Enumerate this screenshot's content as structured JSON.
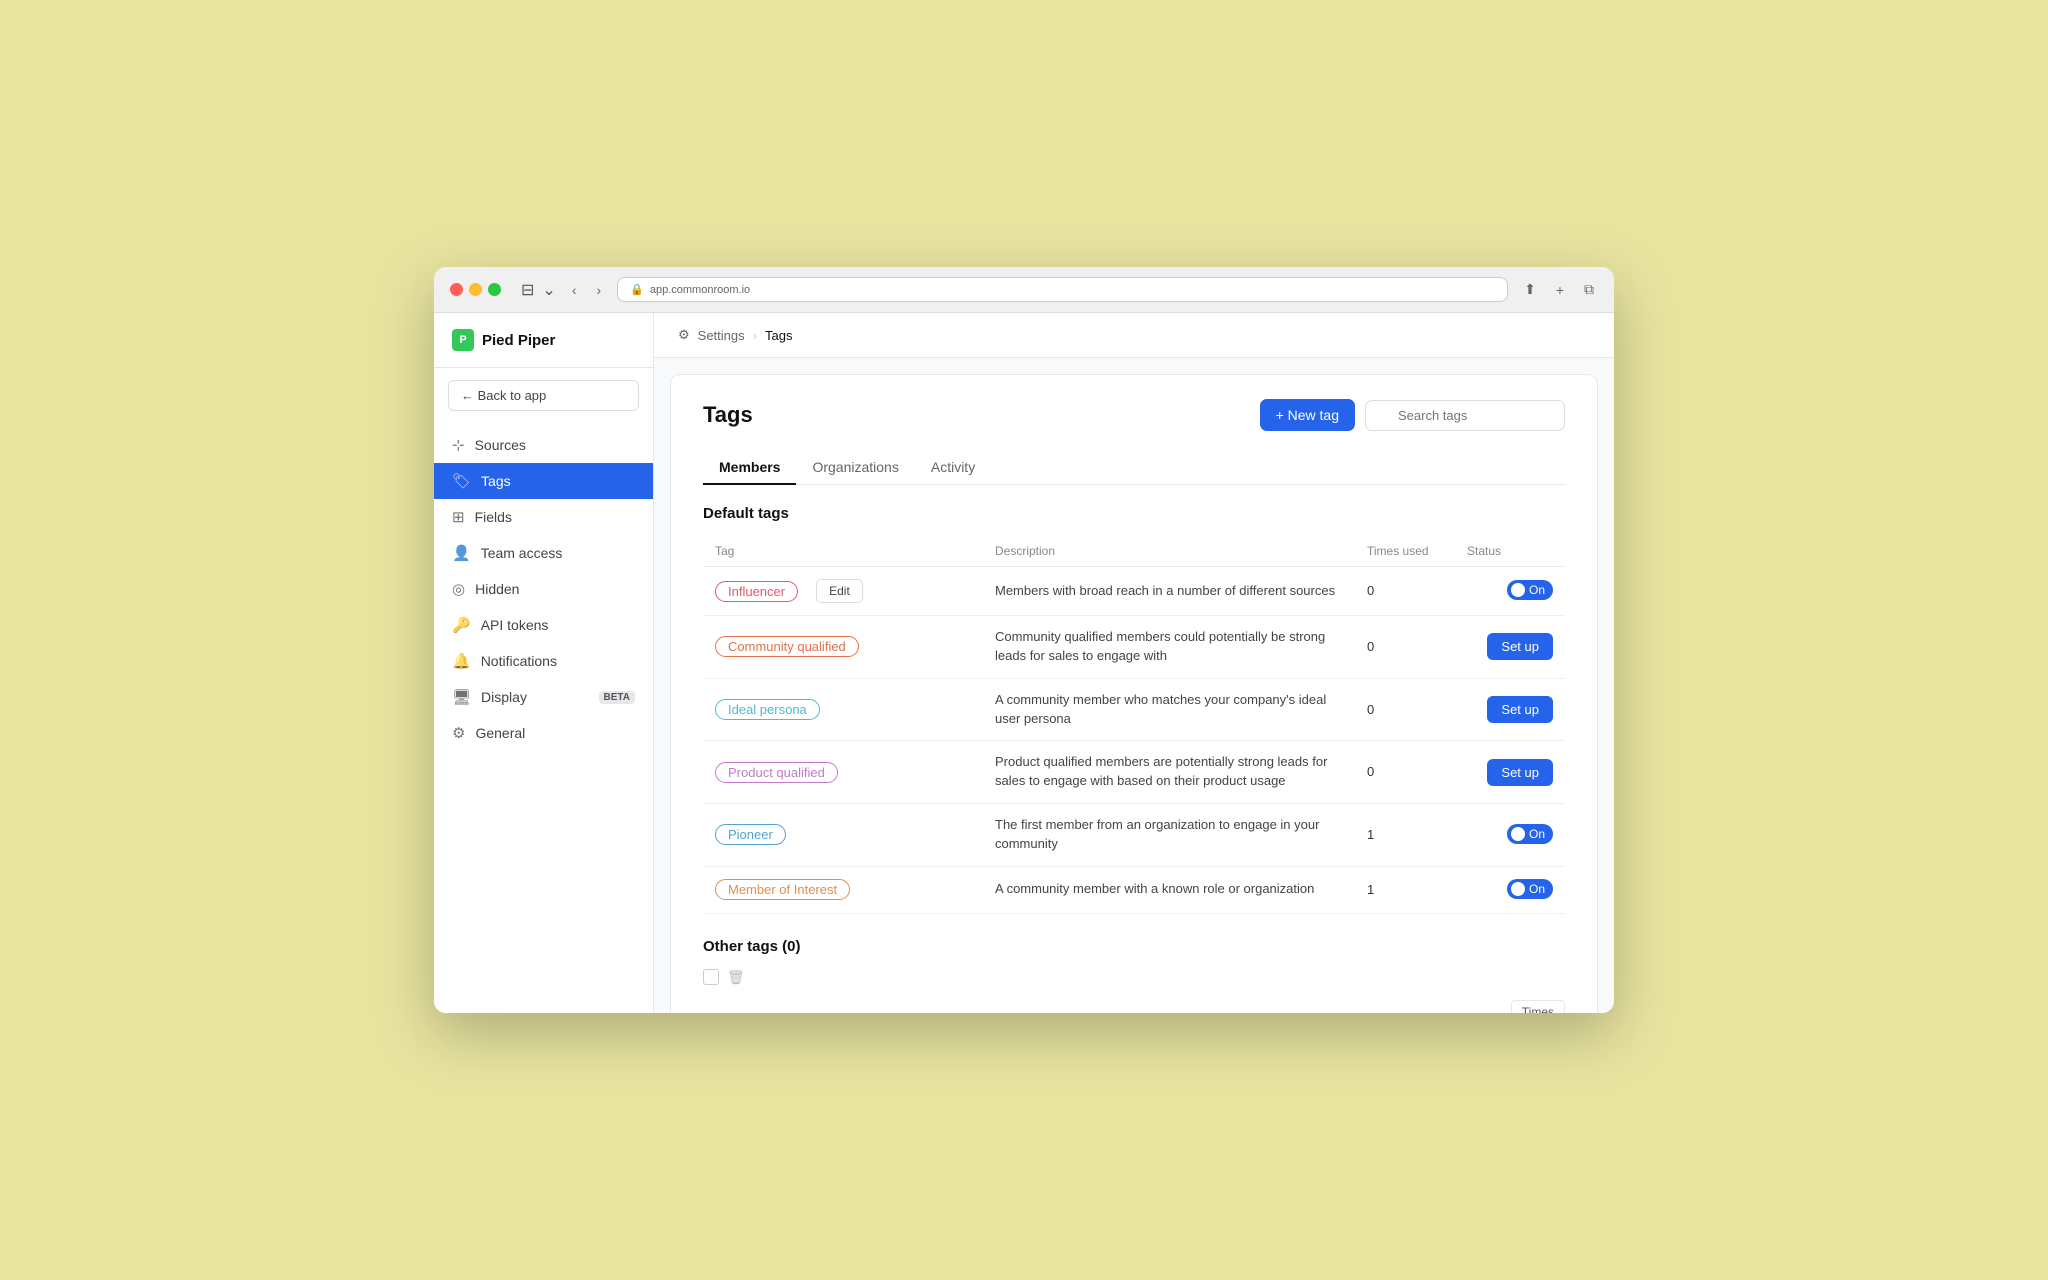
{
  "browser": {
    "url": "app.commonroom.io",
    "reload_icon": "↻"
  },
  "sidebar": {
    "brand": "Pied Piper",
    "back_label": "← Back to app",
    "nav_items": [
      {
        "id": "sources",
        "label": "Sources",
        "icon": "⊹",
        "active": false
      },
      {
        "id": "tags",
        "label": "Tags",
        "icon": "🏷",
        "active": true
      },
      {
        "id": "fields",
        "label": "Fields",
        "icon": "⊞",
        "active": false
      },
      {
        "id": "team-access",
        "label": "Team access",
        "icon": "👤",
        "active": false
      },
      {
        "id": "hidden",
        "label": "Hidden",
        "icon": "◎",
        "active": false
      },
      {
        "id": "api-tokens",
        "label": "API tokens",
        "icon": "🔑",
        "active": false
      },
      {
        "id": "notifications",
        "label": "Notifications",
        "icon": "🔔",
        "active": false
      },
      {
        "id": "display",
        "label": "Display",
        "icon": "🖥",
        "active": false,
        "badge": "BETA"
      },
      {
        "id": "general",
        "label": "General",
        "icon": "⚙",
        "active": false
      }
    ]
  },
  "breadcrumb": {
    "parent": "Settings",
    "current": "Tags"
  },
  "page": {
    "title": "Tags",
    "new_tag_label": "+ New tag",
    "search_placeholder": "Search tags"
  },
  "tabs": [
    {
      "id": "members",
      "label": "Members",
      "active": true
    },
    {
      "id": "organizations",
      "label": "Organizations",
      "active": false
    },
    {
      "id": "activity",
      "label": "Activity",
      "active": false
    }
  ],
  "default_tags_section": {
    "title": "Default tags",
    "columns": [
      "Tag",
      "Description",
      "Times used",
      "Status"
    ],
    "rows": [
      {
        "tag_label": "Influencer",
        "tag_class": "tag-influencer",
        "show_edit": true,
        "edit_label": "Edit",
        "description": "Members with broad reach in a number of different sources",
        "times_used": "0",
        "status_type": "toggle",
        "toggle_label": "On"
      },
      {
        "tag_label": "Community qualified",
        "tag_class": "tag-community",
        "show_edit": false,
        "description": "Community qualified members could potentially be strong leads for sales to engage with",
        "times_used": "0",
        "status_type": "setup",
        "setup_label": "Set up"
      },
      {
        "tag_label": "Ideal persona",
        "tag_class": "tag-ideal",
        "show_edit": false,
        "description": "A community member who matches your company's ideal user persona",
        "times_used": "0",
        "status_type": "setup",
        "setup_label": "Set up"
      },
      {
        "tag_label": "Product qualified",
        "tag_class": "tag-product",
        "show_edit": false,
        "description": "Product qualified members are potentially strong leads for sales to engage with based on their product usage",
        "times_used": "0",
        "status_type": "setup",
        "setup_label": "Set up"
      },
      {
        "tag_label": "Pioneer",
        "tag_class": "tag-pioneer",
        "show_edit": false,
        "description": "The first member from an organization to engage in your community",
        "times_used": "1",
        "status_type": "toggle",
        "toggle_label": "On"
      },
      {
        "tag_label": "Member of Interest",
        "tag_class": "tag-member",
        "show_edit": false,
        "description": "A community member with a known role or organization",
        "times_used": "1",
        "status_type": "toggle",
        "toggle_label": "On"
      }
    ]
  },
  "other_tags_section": {
    "title": "Other tags (0)",
    "times_partial_label": "Times"
  }
}
